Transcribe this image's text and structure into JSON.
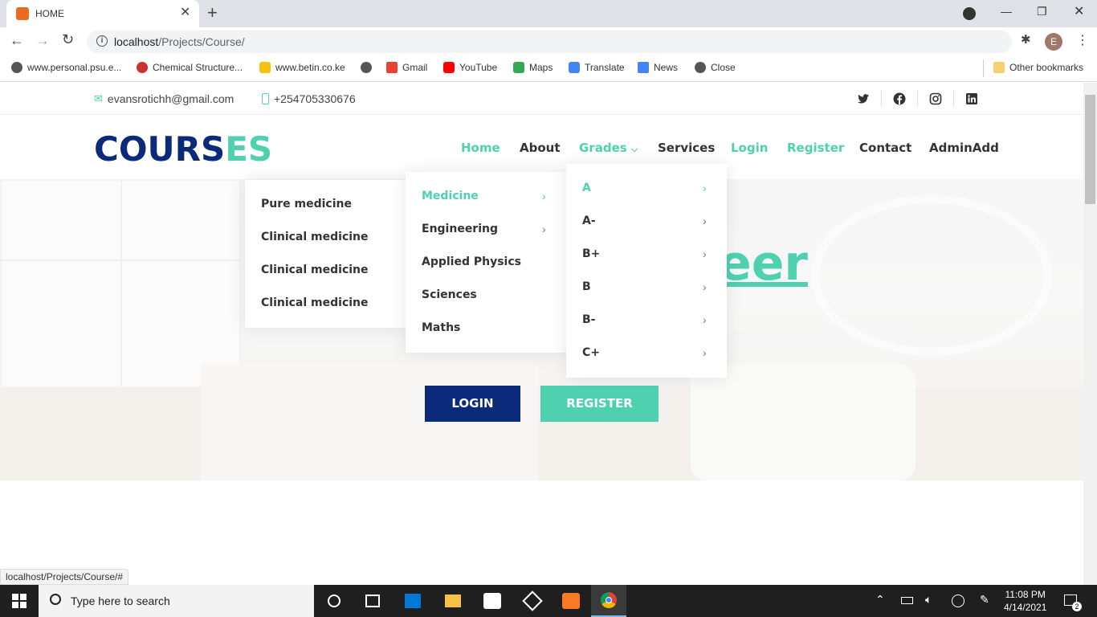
{
  "browser": {
    "tab_title": "HOME",
    "url_host": "localhost",
    "url_path": "/Projects/Course/",
    "bookmarks": [
      "www.personal.psu.e...",
      "Chemical Structure...",
      "www.betin.co.ke",
      "",
      "Gmail",
      "YouTube",
      "Maps",
      "Translate",
      "News",
      "Close"
    ],
    "other_bookmarks": "Other bookmarks",
    "profile_initial": "E",
    "status_url": "localhost/Projects/Course/#"
  },
  "topbar": {
    "email": "evansrotichh@gmail.com",
    "phone": "+254705330676"
  },
  "header": {
    "logo_part1": "COURS",
    "logo_part2": "ES",
    "nav": [
      "Home",
      "About",
      "Grades",
      "Services",
      "Login",
      "Register",
      "Contact",
      "AdminAdd"
    ]
  },
  "hero": {
    "title_fragment": "eer",
    "login_button": "LOGIN",
    "register_button": "REGISTER"
  },
  "menus": {
    "level3": [
      "Pure medicine",
      "Clinical medicine",
      "Clinical medicine",
      "Clinical medicine"
    ],
    "level2": [
      "Medicine",
      "Engineering",
      "Applied Physics",
      "Sciences",
      "Maths"
    ],
    "level1": [
      "A",
      "A-",
      "B+",
      "B",
      "B-",
      "C+"
    ]
  },
  "taskbar": {
    "search_placeholder": "Type here to search",
    "time": "11:08 PM",
    "date": "4/14/2021",
    "notifications": "2"
  },
  "colors": {
    "brand_navy": "#0b2a7a",
    "brand_green": "#4fd1b0"
  }
}
